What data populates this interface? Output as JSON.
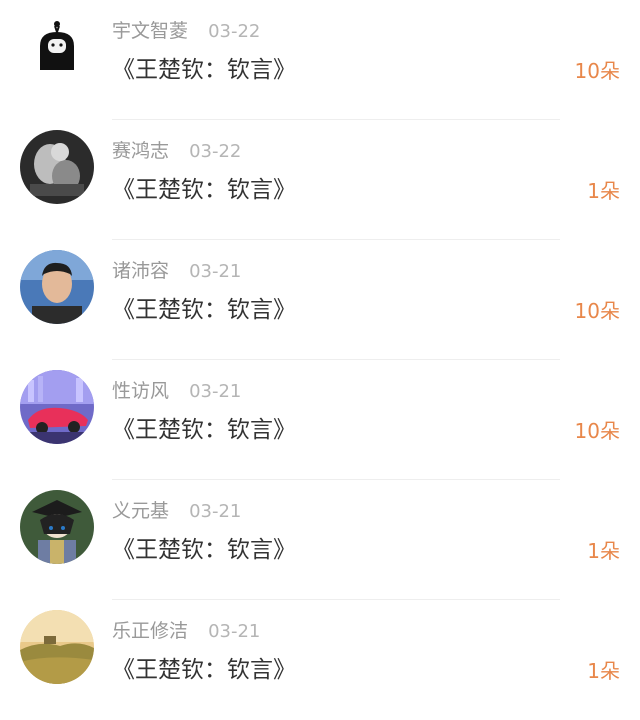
{
  "gifts": [
    {
      "name": "宇文智菱",
      "date": "03-22",
      "title": "《王楚钦：钦言》",
      "count": "10朵",
      "avatar": "ghost-avatar"
    },
    {
      "name": "赛鸿志",
      "date": "03-22",
      "title": "《王楚钦：钦言》",
      "count": "1朵",
      "avatar": "bw-photo-avatar"
    },
    {
      "name": "诸沛容",
      "date": "03-21",
      "title": "《王楚钦：钦言》",
      "count": "10朵",
      "avatar": "man-photo-avatar"
    },
    {
      "name": "性访风",
      "date": "03-21",
      "title": "《王楚钦：钦言》",
      "count": "10朵",
      "avatar": "car-avatar"
    },
    {
      "name": "义元基",
      "date": "03-21",
      "title": "《王楚钦：钦言》",
      "count": "1朵",
      "avatar": "anime-avatar"
    },
    {
      "name": "乐正修洁",
      "date": "03-21",
      "title": "《王楚钦：钦言》",
      "count": "1朵",
      "avatar": "landscape-avatar"
    }
  ],
  "colors": {
    "count": "#e8874a",
    "name": "#999999",
    "title": "#333333"
  }
}
